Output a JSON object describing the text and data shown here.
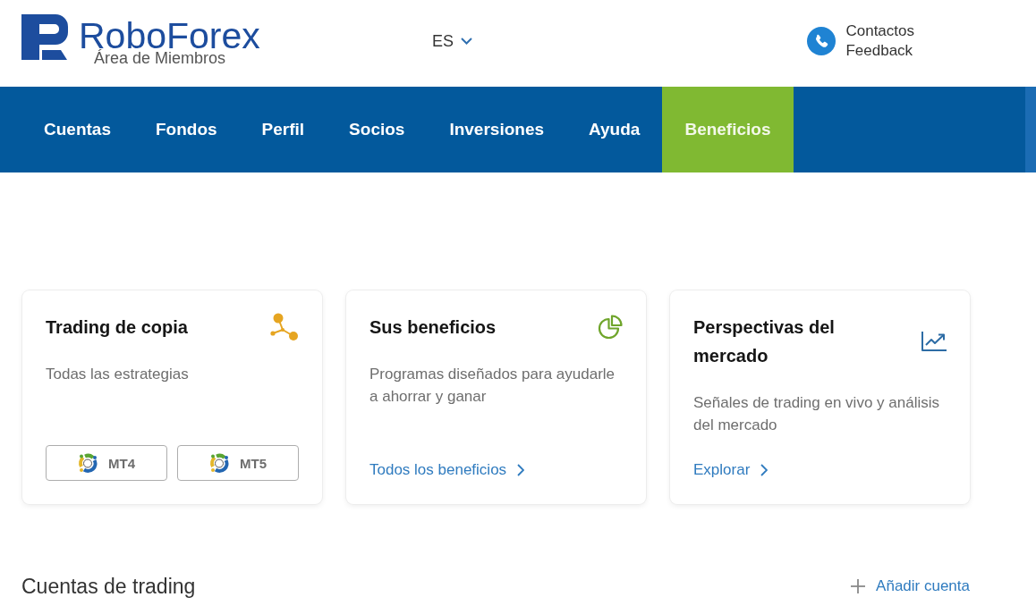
{
  "header": {
    "logo": {
      "brand": "RoboForex",
      "subtitle": "Área de Miembros"
    },
    "language": {
      "label": "ES"
    },
    "contact_links": [
      {
        "label": "Contactos"
      },
      {
        "label": "Feedback"
      }
    ]
  },
  "nav": {
    "items": [
      {
        "label": "Cuentas",
        "selected": false
      },
      {
        "label": "Fondos",
        "selected": false
      },
      {
        "label": "Perfil",
        "selected": false
      },
      {
        "label": "Socios",
        "selected": false
      },
      {
        "label": "Inversiones",
        "selected": false
      },
      {
        "label": "Ayuda",
        "selected": false
      },
      {
        "label": "Beneficios",
        "selected": true
      }
    ]
  },
  "cards": [
    {
      "kind": "platforms",
      "title": "Trading de copia",
      "description": "Todas las estrategias",
      "buttons": [
        {
          "label": "MT4"
        },
        {
          "label": "MT5"
        }
      ]
    },
    {
      "kind": "link",
      "title": "Sus beneficios",
      "description": "Programas diseñados para ayudarle a ahorrar y ganar",
      "link": {
        "label": "Todos los beneficios"
      }
    },
    {
      "kind": "link",
      "title": "Perspectivas del mercado",
      "description": "Señales de trading en vivo y análisis del mercado",
      "link": {
        "label": "Explorar"
      }
    }
  ],
  "accounts": {
    "title": "Cuentas de trading",
    "add_button": {
      "label": "Añadir cuenta"
    }
  }
}
